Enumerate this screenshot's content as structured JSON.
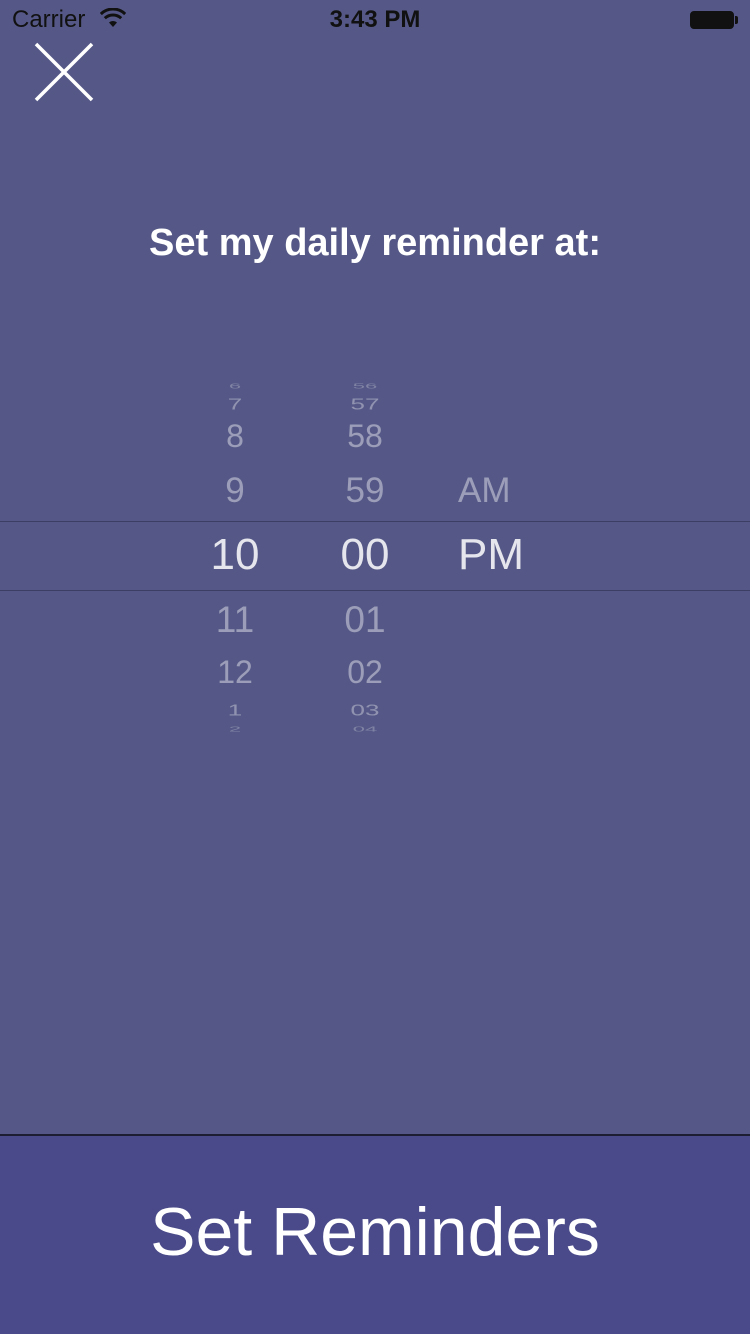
{
  "status_bar": {
    "carrier": "Carrier",
    "time": "3:43 PM"
  },
  "close_icon": "close-icon",
  "heading": "Set my daily reminder at:",
  "picker": {
    "hour": {
      "above_3": "6",
      "above_2": "7",
      "above_1": "8",
      "above_0": "9",
      "selected": "10",
      "below_1": "11",
      "below_2": "12",
      "below_3": "1",
      "below_4": "2"
    },
    "minute": {
      "above_3": "56",
      "above_2": "57",
      "above_1": "58",
      "above_0": "59",
      "selected": "00",
      "below_1": "01",
      "below_2": "02",
      "below_3": "03",
      "below_4": "04"
    },
    "ampm": {
      "above": "AM",
      "selected": "PM"
    }
  },
  "button": {
    "label": "Set Reminders"
  },
  "colors": {
    "background": "#555886",
    "button_background": "#4a4a8a",
    "text": "#ffffff"
  }
}
